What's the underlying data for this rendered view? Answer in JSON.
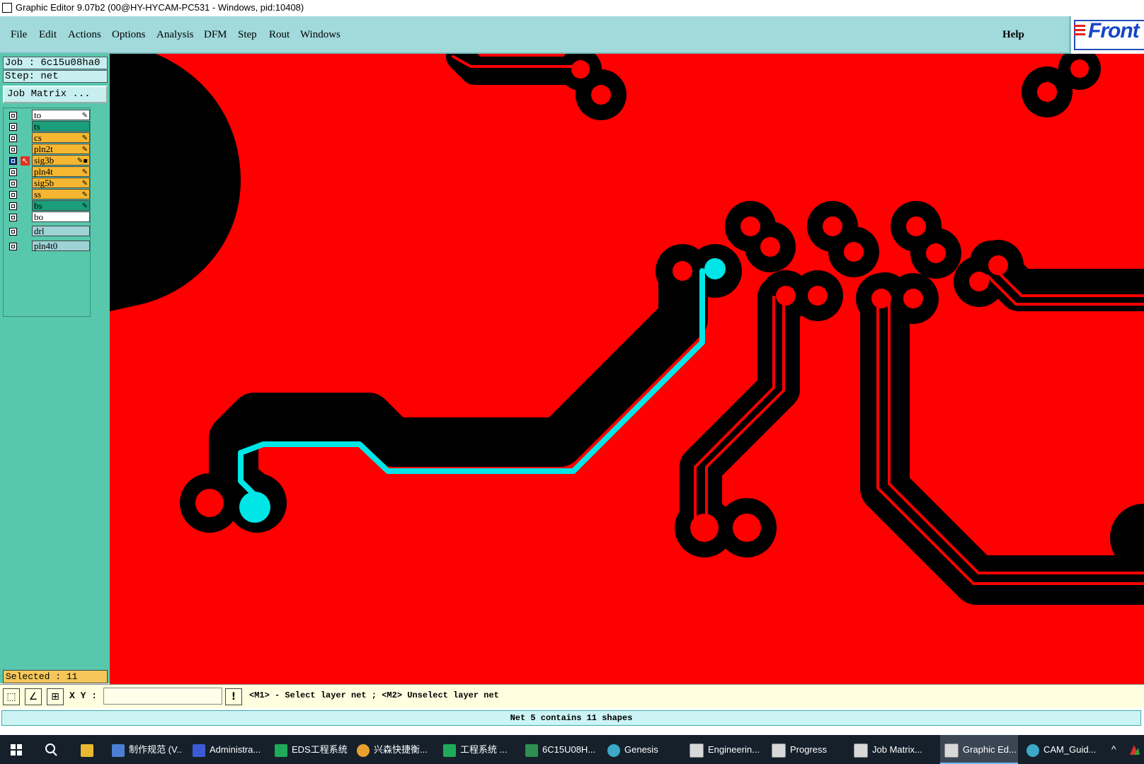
{
  "window": {
    "title": "Graphic Editor 9.07b2 (00@HY-HYCAM-PC531 - Windows, pid:10408)"
  },
  "menu": {
    "items": [
      {
        "label": "File"
      },
      {
        "label": "Edit"
      },
      {
        "label": "Actions"
      },
      {
        "label": "Options"
      },
      {
        "label": "Analysis"
      },
      {
        "label": "DFM"
      },
      {
        "label": "Step"
      },
      {
        "label": "Rout"
      },
      {
        "label": "Windows"
      }
    ],
    "help": "Help",
    "logo": "Front"
  },
  "panel": {
    "job": "Job : 6c15u08ha0",
    "step": "Step: net",
    "job_matrix": "Job Matrix ...",
    "layers": [
      {
        "name": "to",
        "color": "#ffffff",
        "flag": true
      },
      {
        "name": "ts",
        "color": "#1a9e7c",
        "flag": false
      },
      {
        "name": "cs",
        "color": "#f5b731",
        "flag": true
      },
      {
        "name": "pln2t",
        "color": "#f5b731",
        "flag": true
      },
      {
        "name": "sig3b",
        "color": "#f5b731",
        "flag": true,
        "active": true
      },
      {
        "name": "pln4t",
        "color": "#f5b731",
        "flag": true
      },
      {
        "name": "sig5b",
        "color": "#f5b731",
        "flag": true
      },
      {
        "name": "ss",
        "color": "#f5b731",
        "flag": true
      },
      {
        "name": "bs",
        "color": "#1a9e7c",
        "flag": true
      },
      {
        "name": "bo",
        "color": "#ffffff",
        "flag": false
      },
      {
        "name": "drl",
        "color": "#9ed3d6",
        "flag": false
      },
      {
        "name": "pln4t0",
        "color": "#9ed3d6",
        "flag": false
      }
    ],
    "selected": "Selected : 11"
  },
  "toolbar": {
    "xy_label": "X Y :",
    "xy_value": "",
    "hint": "<M1> - Select layer net ; <M2> Unselect layer net"
  },
  "status": "Net 5 contains 11 shapes",
  "taskbar": {
    "items": [
      {
        "label": "制作规范 (V...",
        "color": "#4a7fd4"
      },
      {
        "label": "Administra...",
        "color": "#3b5bd6"
      },
      {
        "label": "EDS工程系统",
        "color": "#1faa5a"
      },
      {
        "label": "兴森快捷衡...",
        "color": "#e8a030"
      },
      {
        "label": "工程系统 ...",
        "color": "#1faa5a"
      },
      {
        "label": "6C15U08H...",
        "color": "#2f8f4f"
      },
      {
        "label": "Genesis",
        "color": "#3ca9c8"
      },
      {
        "label": "Engineerin...",
        "color": "#d8d8d8"
      },
      {
        "label": "Progress",
        "color": "#d8d8d8"
      },
      {
        "label": "Job Matrix...",
        "color": "#d8d8d8"
      },
      {
        "label": "Graphic Ed...",
        "color": "#d8d8d8",
        "active": true
      },
      {
        "label": "CAM_Guid...",
        "color": "#3ca9c8"
      }
    ]
  },
  "colors": {
    "board": "#ff0000",
    "trace": "#000000",
    "highlight": "#00e5e5"
  }
}
